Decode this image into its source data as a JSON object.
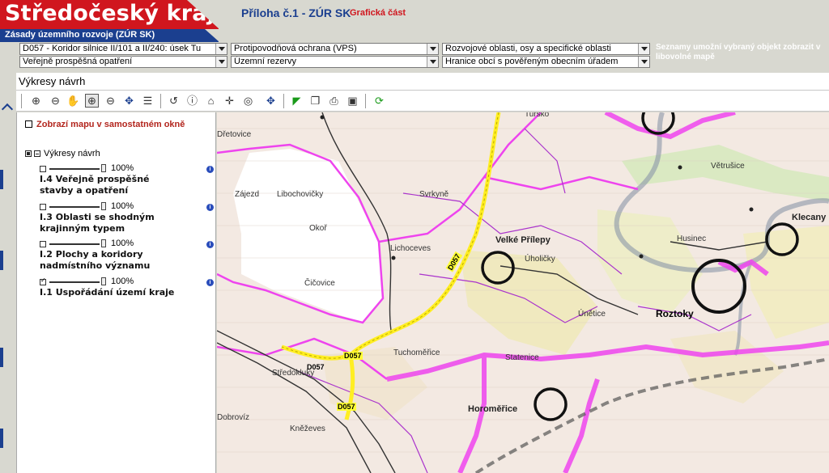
{
  "header": {
    "logo_title": "Středočeský kraj",
    "logo_subtitle": "Zásady územního rozvoje (ZÚR SK)",
    "title": "Příloha č.1 - ZÚR SK",
    "subtitle": "Grafická část",
    "hint": "Seznamy umožní vybraný objekt zobrazit v libovolné mapě"
  },
  "selects": {
    "s1": "D057 - Koridor silnice II/101 a II/240: úsek Tu",
    "s2": "Protipovodňová ochrana (VPS)",
    "s3": "Rozvojové oblasti, osy a specifické oblasti",
    "s4": "Veřejně prospěšná opatření",
    "s5": "Územní rezervy",
    "s6": "Hranice obcí s pověřeným obecním úřadem"
  },
  "section": {
    "title": "Výkresy návrh"
  },
  "panel": {
    "open_map": "Zobrazí mapu v samostatném okně",
    "root_label": "Výkresy návrh",
    "layers": [
      {
        "opacity": "100%",
        "name": "I.4 Veřejně prospěšné stavby a opatření",
        "checked": false
      },
      {
        "opacity": "100%",
        "name": "I.3 Oblasti se shodným krajinným typem",
        "checked": false
      },
      {
        "opacity": "100%",
        "name": "I.2 Plochy a koridory nadmístního významu",
        "checked": false
      },
      {
        "opacity": "100%",
        "name": "I.1 Uspořádání území kraje",
        "checked": true
      }
    ]
  },
  "map": {
    "places": {
      "dretovice": "Dřetovice",
      "zajezd": "Zájezd",
      "libochovicky": "Libochovičky",
      "svrkyne": "Svrkyně",
      "okor": "Okoř",
      "lichoceves": "Lichoceves",
      "velke_prilepy": "Velké Přílepy",
      "uholicky": "Úholičky",
      "husinec": "Husinec",
      "klecany": "Klecany",
      "vetrusice": "Větrušice",
      "turskoo": "Tursko",
      "cicovice": "Čičovice",
      "roztoky": "Roztoky",
      "unetice": "Únětice",
      "tuchomerice": "Tuchoměřice",
      "statenice": "Statenice",
      "stredokluky": "Středokluky",
      "horomerice": "Horoměřice",
      "knezeves": "Kněževes",
      "dobrovic": "Dobrovíz"
    },
    "road_code": "D057"
  },
  "colors": {
    "brand_red": "#d0161e",
    "brand_blue": "#1b3f8f",
    "boundary_magenta": "#ee44ee",
    "corridor_yellow": "#ffee22"
  }
}
